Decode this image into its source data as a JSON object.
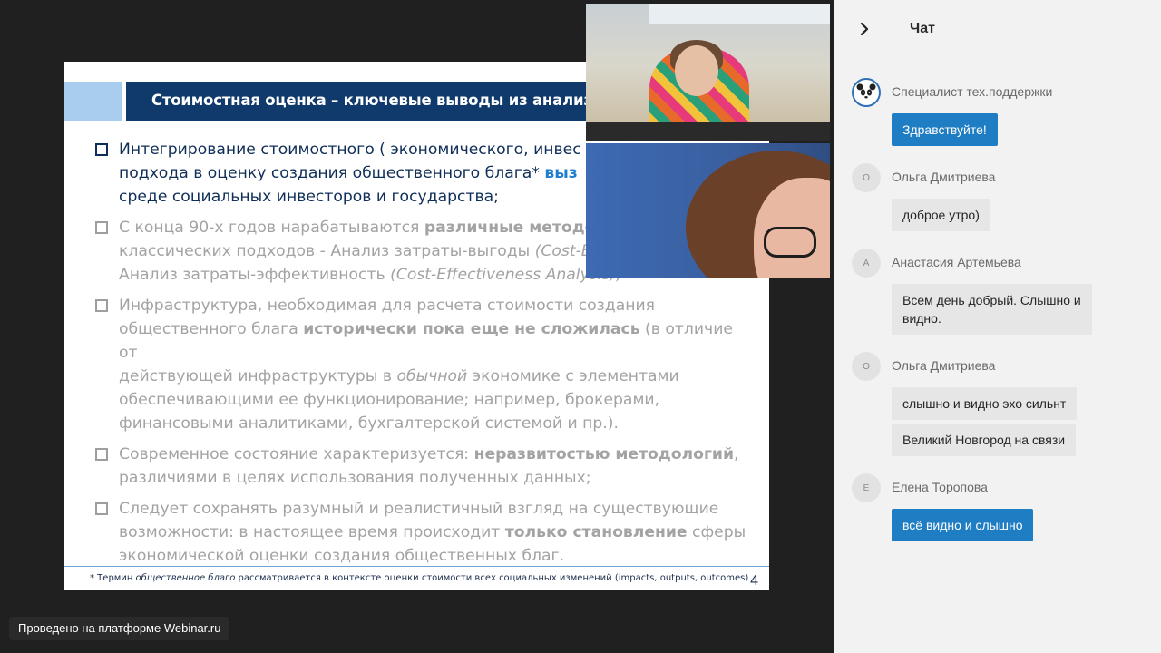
{
  "slide": {
    "title": "Стоимостная оценка – ключевые выводы из анализа ме",
    "bullets": [
      {
        "state": "active",
        "parts": [
          {
            "t": "Интегрирование стоимостного ( экономического, инвес"
          },
          {
            "t": "\n"
          },
          {
            "t": "подхода в оценку создания общественного блага* "
          },
          {
            "t": "выз",
            "s": "blue"
          },
          {
            "t": "\n"
          },
          {
            "t": "среде социальных инвесторов и государства;"
          }
        ]
      },
      {
        "state": "dim",
        "parts": [
          {
            "t": "С конца 90-х годов нарабатываются "
          },
          {
            "t": "различные методол",
            "s": "strong"
          },
          {
            "t": "\n"
          },
          {
            "t": "классических подходов - Анализ затраты-выгоды "
          },
          {
            "t": "(Cost-B",
            "s": "italic"
          },
          {
            "t": "\n"
          },
          {
            "t": "Анализ затраты-эффективность "
          },
          {
            "t": "(Cost-Effectiveness Analysis);",
            "s": "italic"
          }
        ]
      },
      {
        "state": "dim",
        "parts": [
          {
            "t": "Инфраструктура, необходимая для расчета стоимости создания"
          },
          {
            "t": "\n"
          },
          {
            "t": "общественного блага "
          },
          {
            "t": "исторически пока  еще не сложилась",
            "s": "strong"
          },
          {
            "t": " (в отличие от"
          },
          {
            "t": "\n"
          },
          {
            "t": "действующей инфраструктуры в "
          },
          {
            "t": "обычной",
            "s": "italic"
          },
          {
            "t": " экономике  с элементами"
          },
          {
            "t": "\n"
          },
          {
            "t": "обеспечивающими ее функционирование; например, брокерами,"
          },
          {
            "t": "\n"
          },
          {
            "t": "финансовыми аналитиками,  бухгалтерской системой и пр.)."
          }
        ]
      },
      {
        "state": "dim",
        "parts": [
          {
            "t": "Современное состояние характеризуется: "
          },
          {
            "t": "неразвитостью методологий",
            "s": "strong"
          },
          {
            "t": ","
          },
          {
            "t": "\n"
          },
          {
            "t": "различиями в целях использования полученных данных;"
          }
        ]
      },
      {
        "state": "dim",
        "parts": [
          {
            "t": "Следует сохранять разумный и реалистичный взгляд на существующие"
          },
          {
            "t": "\n"
          },
          {
            "t": "возможности: в настоящее время происходит "
          },
          {
            "t": "только становление",
            "s": "strong"
          },
          {
            "t": " сферы"
          },
          {
            "t": "\n"
          },
          {
            "t": "экономической оценки создания общественных благ."
          }
        ]
      }
    ],
    "footnote_prefix": "* Термин ",
    "footnote_term": "общественное благо",
    "footnote_suffix": " рассматривается в контексте оценки стоимости всех социальных изменений (impacts, outputs, outcomes)",
    "page_number": "4"
  },
  "branding": {
    "label": "Проведено на платформе Webinar.ru"
  },
  "chat": {
    "title": "Чат",
    "collapse_icon": "chevron-right-icon",
    "messages": [
      {
        "author": "Специалист тех.поддержки",
        "avatar": "panda-icon",
        "style": "blue",
        "lines": [
          "Здравствуйте!"
        ]
      },
      {
        "author": "Ольга Дмитриева",
        "avatar": "О",
        "style": "gray",
        "lines": [
          "доброе утро)"
        ]
      },
      {
        "author": "Анастасия Артемьева",
        "avatar": "А",
        "style": "gray",
        "lines": [
          "Всем день добрый. Слышно и\nвидно."
        ]
      },
      {
        "author": "Ольга Дмитриева",
        "avatar": "О",
        "style": "gray",
        "lines": [
          "слышно и видно эхо сильнт",
          "Великий Новгород на связи"
        ]
      },
      {
        "author": "Елена Торопова",
        "avatar": "Е",
        "style": "blue",
        "lines": [
          "всё видно и слышно"
        ]
      }
    ]
  },
  "colors": {
    "slide_title_bar": "#103a6b",
    "slide_accent": "#a9cdee",
    "chat_blue": "#1f7dc4",
    "chat_gray": "#e6e6e6"
  }
}
